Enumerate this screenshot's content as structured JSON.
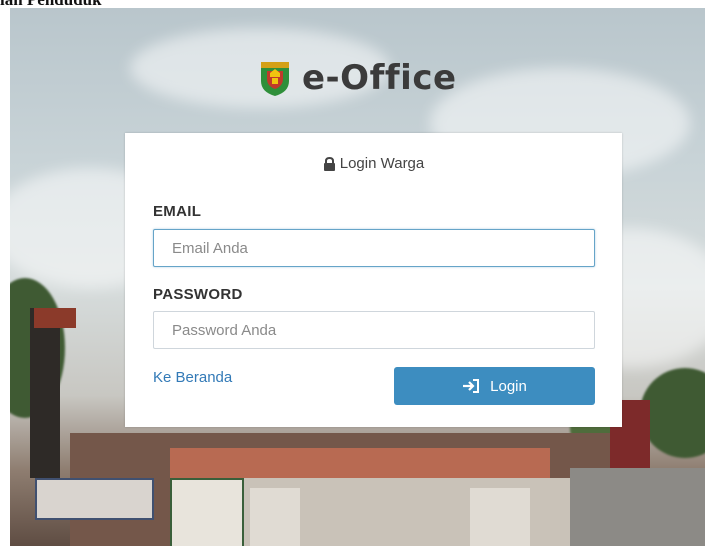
{
  "caption": "ian Penduduk",
  "brand": {
    "title": "e-Office"
  },
  "login_form": {
    "heading": "Login Warga",
    "email_label": "EMAIL",
    "email_placeholder": "Email Anda",
    "password_label": "PASSWORD",
    "password_placeholder": "Password Anda",
    "home_link": "Ke Beranda",
    "login_button": "Login"
  },
  "icons": {
    "heading_icon": "lock-icon",
    "button_icon": "sign-in-icon",
    "logo_icon": "emblem-icon"
  },
  "colors": {
    "button": "#3d8dc0",
    "link": "#337ab7",
    "brand_text": "#3b3b3b"
  }
}
